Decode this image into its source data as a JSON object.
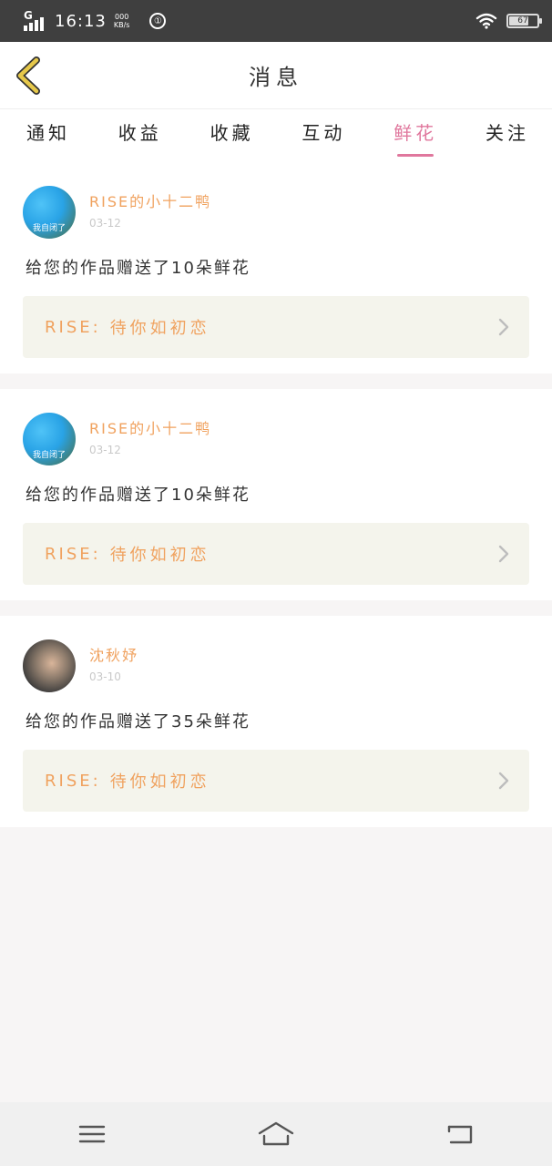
{
  "status_bar": {
    "network": "G",
    "time": "16:13",
    "speed_value": "000",
    "speed_unit": "KB/s",
    "circle_icon_text": "①",
    "battery_level": "67",
    "icons": [
      "signal-icon",
      "wifi-icon",
      "battery-icon"
    ]
  },
  "header": {
    "title": "消息",
    "back_icon": "chevron-left-icon",
    "accent_color": "#e6c84a"
  },
  "tabs": [
    {
      "label": "通知",
      "active": false
    },
    {
      "label": "收益",
      "active": false
    },
    {
      "label": "收藏",
      "active": false
    },
    {
      "label": "互动",
      "active": false
    },
    {
      "label": "鲜花",
      "active": true
    },
    {
      "label": "关注",
      "active": false
    }
  ],
  "colors": {
    "active_tab": "#e0779d",
    "username": "#f0a25f",
    "work_box_bg": "#f4f4ec"
  },
  "messages": [
    {
      "username": "RISE的小十二鸭",
      "date": "03-12",
      "avatar_caption": "我自闭了",
      "body": "给您的作品赠送了10朵鲜花",
      "work_label": "RISE:",
      "work_title": "待你如初恋"
    },
    {
      "username": "RISE的小十二鸭",
      "date": "03-12",
      "avatar_caption": "我自闭了",
      "body": "给您的作品赠送了10朵鲜花",
      "work_label": "RISE:",
      "work_title": "待你如初恋"
    },
    {
      "username": "沈秋妤",
      "date": "03-10",
      "avatar_caption": "",
      "body": "给您的作品赠送了35朵鲜花",
      "work_label": "RISE:",
      "work_title": "待你如初恋"
    }
  ],
  "nav_bar": {
    "icons": [
      "menu-icon",
      "home-icon",
      "back-icon"
    ]
  }
}
